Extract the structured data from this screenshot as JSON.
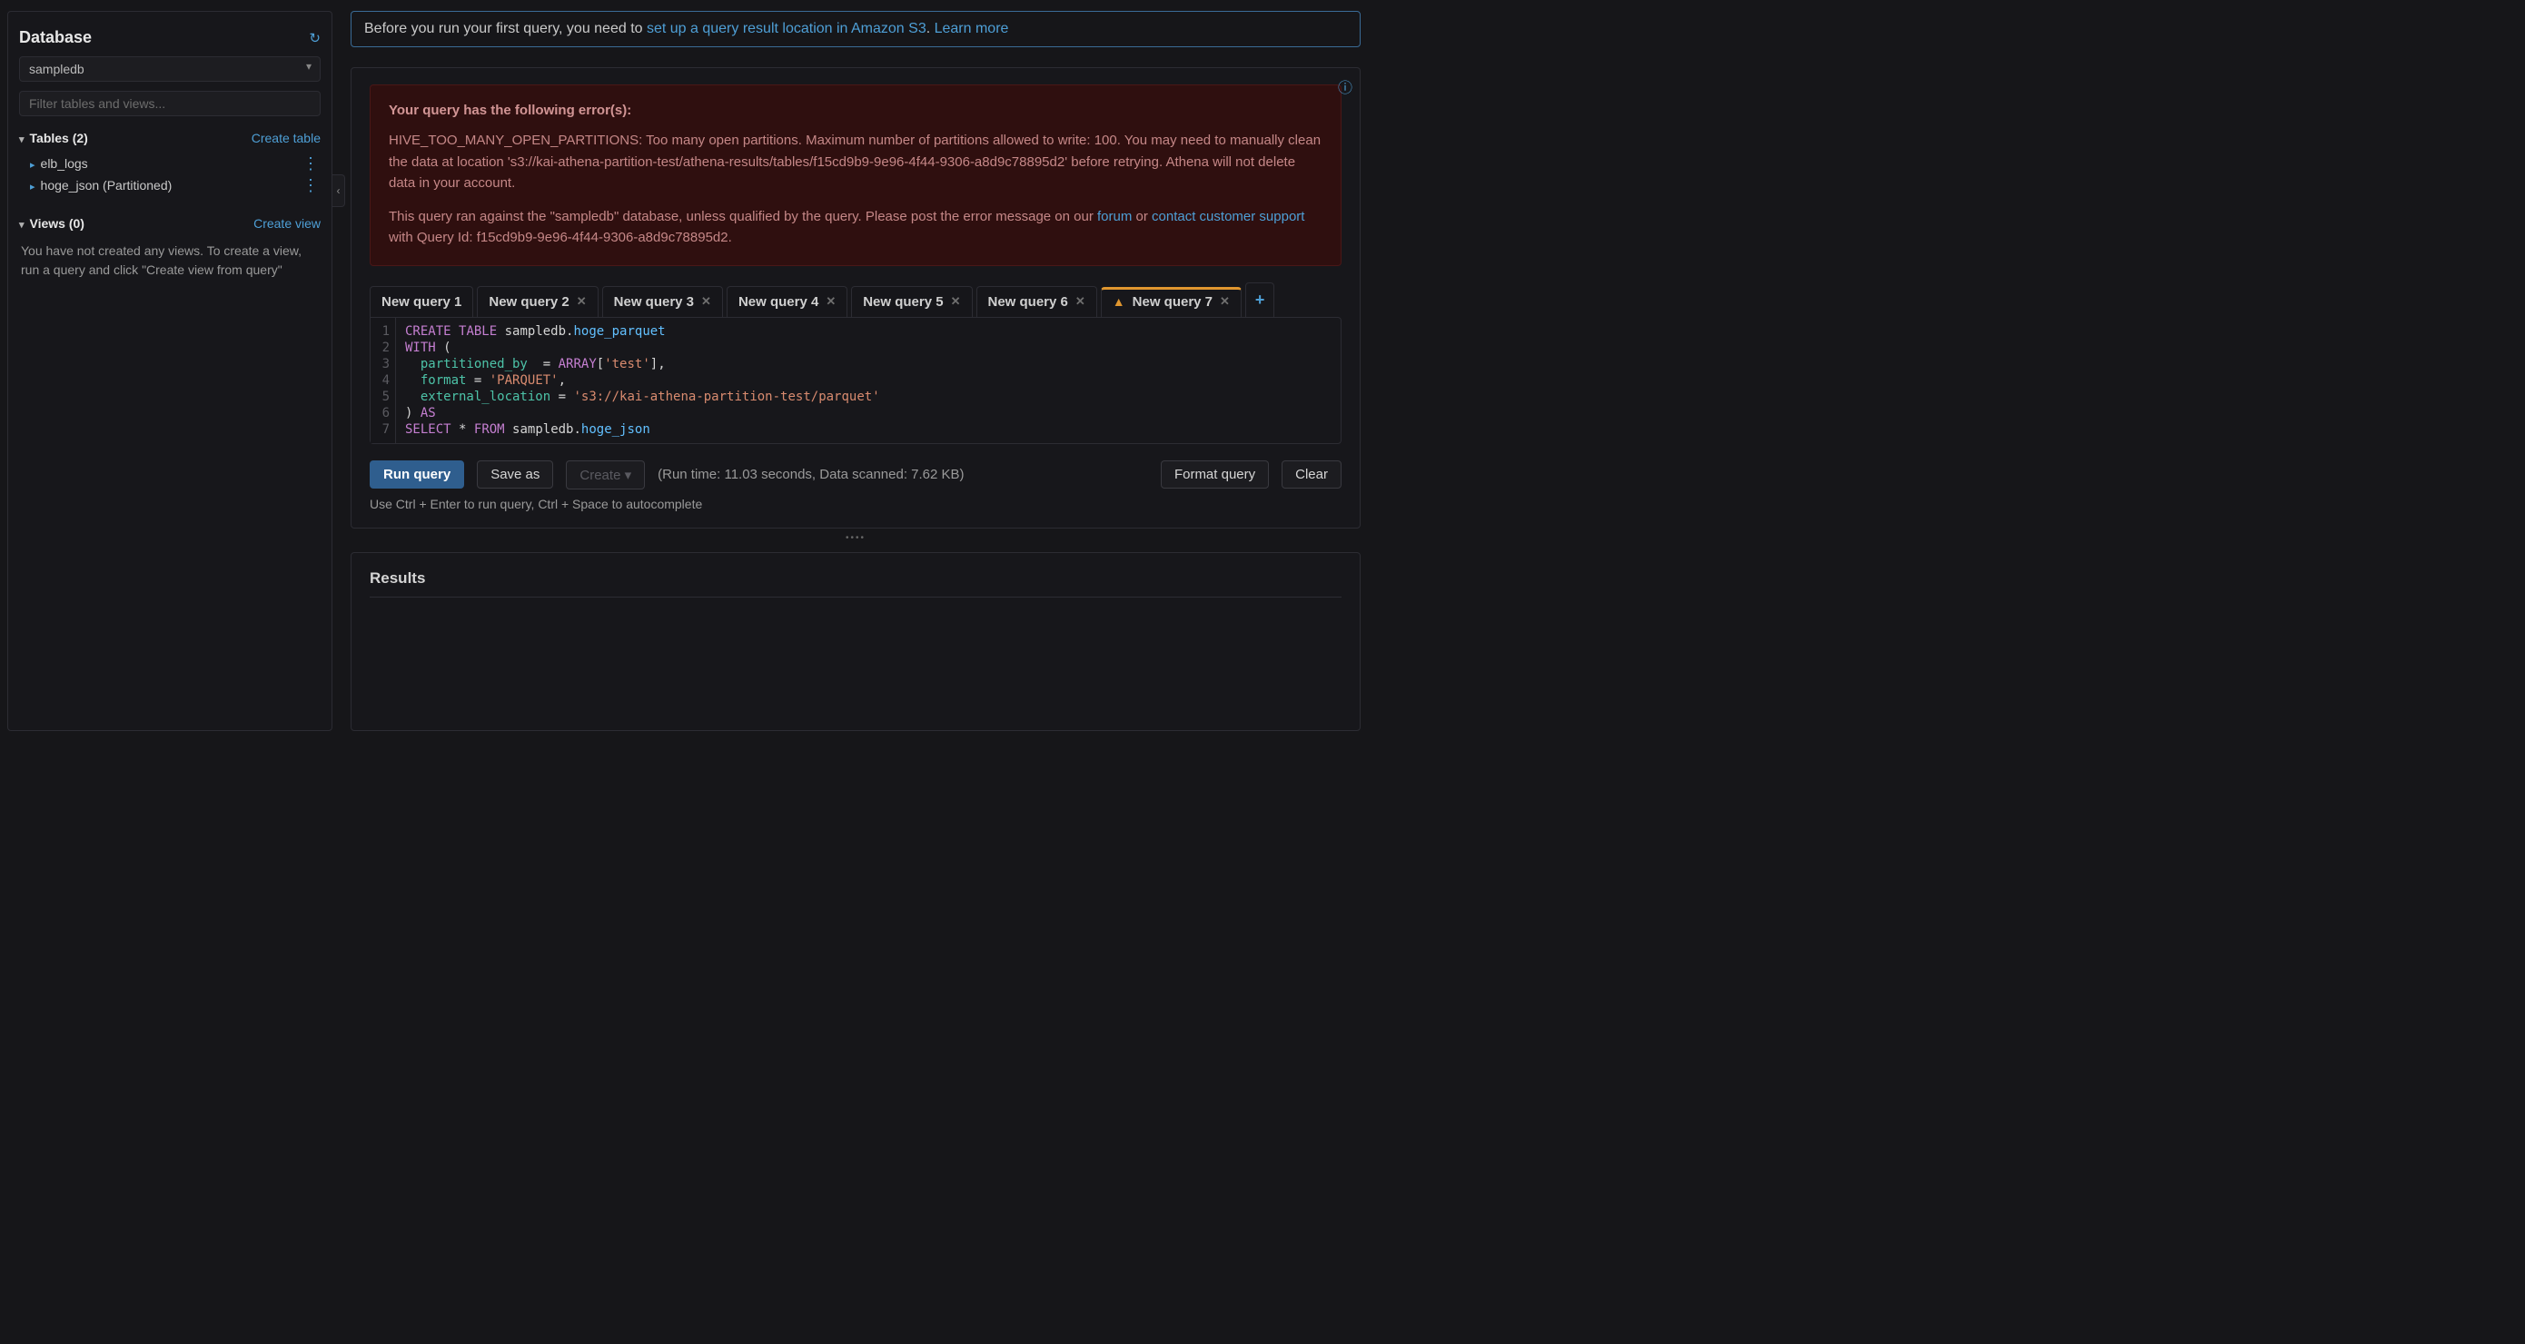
{
  "sidebar": {
    "title": "Database",
    "selected_db": "sampledb",
    "filter_placeholder": "Filter tables and views...",
    "tables_header": "Tables (2)",
    "create_table_label": "Create table",
    "tables": [
      {
        "name": "elb_logs"
      },
      {
        "name": "hoge_json (Partitioned)"
      }
    ],
    "views_header": "Views (0)",
    "create_view_label": "Create view",
    "views_empty": "You have not created any views. To create a view, run a query and click \"Create view from query\""
  },
  "notice": {
    "prefix": "Before you run your first query, you need to ",
    "link1": "set up a query result location in Amazon S3",
    "mid": ". ",
    "link2": "Learn more"
  },
  "error": {
    "title": "Your query has the following error(s):",
    "body1": "HIVE_TOO_MANY_OPEN_PARTITIONS: Too many open partitions. Maximum number of partitions allowed to write: 100. You may need to manually clean the data at location 's3://kai-athena-partition-test/athena-results/tables/f15cd9b9-9e96-4f44-9306-a8d9c78895d2' before retrying. Athena will not delete data in your account.",
    "body2_pre": "This query ran against the \"sampledb\" database, unless qualified by the query. Please post the error message on our ",
    "forum": "forum",
    "body2_mid": " or ",
    "support": "contact customer support",
    "body2_post": " with Query Id: f15cd9b9-9e96-4f44-9306-a8d9c78895d2."
  },
  "tabs": [
    {
      "label": "New query 1",
      "closable": false
    },
    {
      "label": "New query 2",
      "closable": true
    },
    {
      "label": "New query 3",
      "closable": true
    },
    {
      "label": "New query 4",
      "closable": true
    },
    {
      "label": "New query 5",
      "closable": true
    },
    {
      "label": "New query 6",
      "closable": true
    },
    {
      "label": "New query 7",
      "closable": true,
      "active": true,
      "warn": true
    }
  ],
  "editor": {
    "lines": [
      "1",
      "2",
      "3",
      "4",
      "5",
      "6",
      "7"
    ]
  },
  "actions": {
    "run": "Run query",
    "save": "Save as",
    "create": "Create",
    "runinfo": "(Run time: 11.03 seconds, Data scanned: 7.62 KB)",
    "format": "Format query",
    "clear": "Clear",
    "hint": "Use Ctrl + Enter to run query, Ctrl + Space to autocomplete"
  },
  "results": {
    "title": "Results"
  }
}
